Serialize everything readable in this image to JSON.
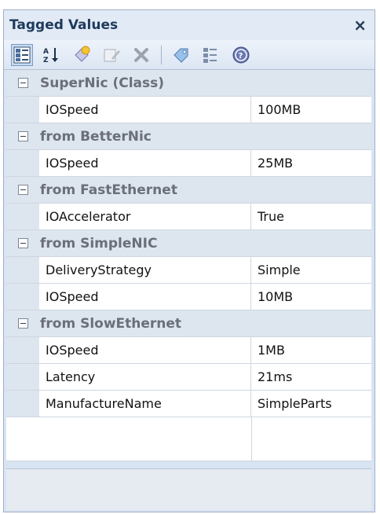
{
  "panel": {
    "title": "Tagged Values",
    "close_glyph": "×"
  },
  "toolbar": {
    "icons": [
      "categorized-view-icon",
      "sort-alphabetical-icon",
      "new-tag-icon",
      "edit-tag-icon",
      "delete-icon",
      "tag-icon",
      "show-inherited-icon",
      "help-icon"
    ]
  },
  "groups": [
    {
      "label": "SuperNic (Class)",
      "rows": [
        {
          "name": "IOSpeed",
          "value": "100MB"
        }
      ]
    },
    {
      "label": "from BetterNic",
      "rows": [
        {
          "name": "IOSpeed",
          "value": "25MB"
        }
      ]
    },
    {
      "label": "from FastEthernet",
      "rows": [
        {
          "name": "IOAccelerator",
          "value": "True"
        }
      ]
    },
    {
      "label": "from SimpleNIC",
      "rows": [
        {
          "name": "DeliveryStrategy",
          "value": "Simple"
        },
        {
          "name": "IOSpeed",
          "value": "10MB"
        }
      ]
    },
    {
      "label": "from SlowEthernet",
      "rows": [
        {
          "name": "IOSpeed",
          "value": "1MB"
        },
        {
          "name": "Latency",
          "value": "21ms"
        },
        {
          "name": "ManufactureName",
          "value": "SimpleParts"
        }
      ]
    }
  ]
}
